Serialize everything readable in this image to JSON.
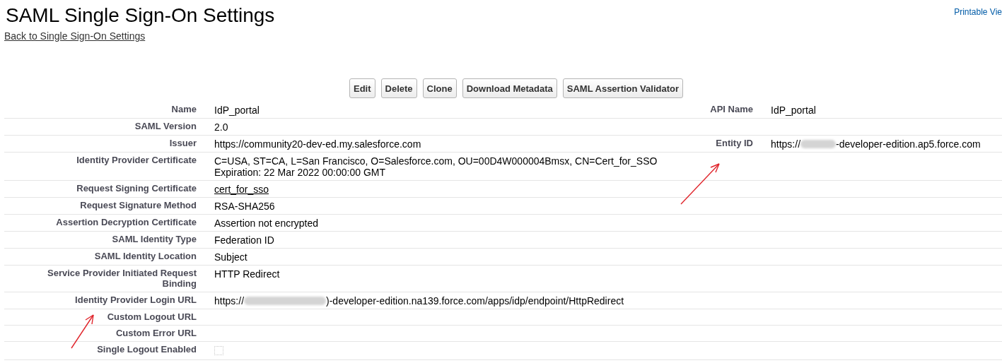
{
  "page": {
    "title": "SAML Single Sign-On Settings",
    "back_link": "Back to Single Sign-On Settings",
    "printable_link": "Printable Vie"
  },
  "buttons": [
    "Edit",
    "Delete",
    "Clone",
    "Download Metadata",
    "SAML Assertion Validator"
  ],
  "rows": [
    {
      "label": "Name",
      "value": {
        "kind": "text",
        "text": "IdP_portal"
      },
      "right_label": "API Name",
      "right_value": {
        "kind": "text",
        "text": "IdP_portal"
      }
    },
    {
      "label": "SAML Version",
      "value": {
        "kind": "text",
        "text": "2.0"
      }
    },
    {
      "label": "Issuer",
      "value": {
        "kind": "text",
        "text": "https://community20-dev-ed.my.salesforce.com"
      },
      "right_label": "Entity ID",
      "right_value": {
        "kind": "redacted",
        "prefix": "https://",
        "suffix": "-developer-edition.ap5.force.com"
      }
    },
    {
      "label": "Identity Provider Certificate",
      "value": {
        "kind": "lines",
        "lines": [
          "C=USA, ST=CA, L=San Francisco, O=Salesforce.com, OU=00D4W000004Bmsx, CN=Cert_for_SSO",
          "Expiration: 22 Mar 2022 00:00:00 GMT"
        ]
      }
    },
    {
      "label": "Request Signing Certificate",
      "value": {
        "kind": "link",
        "text": "cert_for_sso"
      }
    },
    {
      "label": "Request Signature Method",
      "value": {
        "kind": "text",
        "text": "RSA-SHA256"
      }
    },
    {
      "label": "Assertion Decryption Certificate",
      "value": {
        "kind": "text",
        "text": "Assertion not encrypted"
      }
    },
    {
      "label": "SAML Identity Type",
      "value": {
        "kind": "text",
        "text": "Federation ID"
      }
    },
    {
      "label": "SAML Identity Location",
      "value": {
        "kind": "text",
        "text": "Subject"
      }
    },
    {
      "label": "Service Provider Initiated Request Binding",
      "value": {
        "kind": "text",
        "text": "HTTP Redirect"
      }
    },
    {
      "label": "Identity Provider Login URL",
      "value": {
        "kind": "redacted",
        "prefix": "https://",
        "suffix": ")-developer-edition.na139.force.com/apps/idp/endpoint/HttpRedirect",
        "wide": true
      }
    },
    {
      "label": "Custom Logout URL"
    },
    {
      "label": "Custom Error URL"
    },
    {
      "label": "Single Logout Enabled",
      "value": {
        "kind": "checkbox",
        "checked": false
      }
    }
  ]
}
